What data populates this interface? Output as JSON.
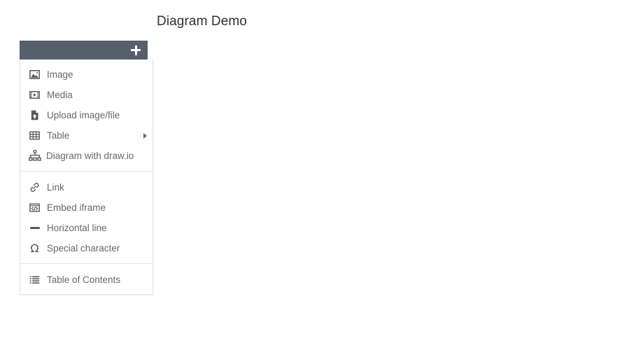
{
  "page": {
    "title": "Diagram Demo",
    "background_color": "#ffffff",
    "title_color": "#303030"
  },
  "toolbar": {
    "background_color": "#565f6c",
    "add_button": {
      "icon": "plus-icon",
      "label": "+"
    }
  },
  "dropdown": {
    "border_color": "#e4e4e4",
    "label_color": "#676767",
    "groups": [
      {
        "items": [
          {
            "label": "Image",
            "icon": "image-icon",
            "has_submenu": false
          },
          {
            "label": "Media",
            "icon": "media-icon",
            "has_submenu": false
          },
          {
            "label": "Upload image/file",
            "icon": "upload-file-icon",
            "has_submenu": false
          },
          {
            "label": "Table",
            "icon": "table-grid-icon",
            "has_submenu": true
          },
          {
            "label": "Diagram with draw.io",
            "icon": "sitemap-icon",
            "has_submenu": false
          }
        ]
      },
      {
        "items": [
          {
            "label": "Link",
            "icon": "chain-link-icon",
            "has_submenu": false
          },
          {
            "label": "Embed iframe",
            "icon": "code-embed-icon",
            "has_submenu": false
          },
          {
            "label": "Horizontal line",
            "icon": "horizontal-line-icon",
            "has_submenu": false
          },
          {
            "label": "Special character",
            "icon": "omega-icon",
            "has_submenu": false
          }
        ]
      },
      {
        "items": [
          {
            "label": "Table of Contents",
            "icon": "list-bullet-icon",
            "has_submenu": false
          }
        ]
      }
    ]
  }
}
